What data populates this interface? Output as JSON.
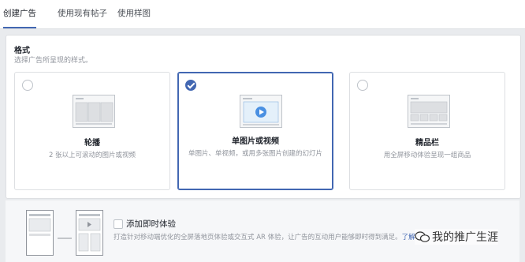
{
  "tabs": [
    {
      "label": "创建广告",
      "active": true
    },
    {
      "label": "使用现有帖子",
      "active": false
    },
    {
      "label": "使用样图",
      "active": false
    }
  ],
  "format": {
    "title": "格式",
    "subtitle": "选择广告所呈现的样式。",
    "options": [
      {
        "title": "轮播",
        "description": "2 张以上可滚动的图片或视频",
        "selected": false,
        "icon": "carousel-icon"
      },
      {
        "title": "单图片或视频",
        "description": "单图片、单视频，或用多张图片创建的幻灯片",
        "selected": true,
        "icon": "single-media-icon"
      },
      {
        "title": "精品栏",
        "description": "用全屏移动体验呈现一组商品",
        "selected": false,
        "icon": "collection-icon"
      }
    ]
  },
  "instant_experience": {
    "title": "添加即时体验",
    "description": "打造针对移动端优化的全屏落地页体验或交互式 AR 体验，让广告的互动用户能够即时得到满足。",
    "link": "了解",
    "checked": false
  },
  "watermark": {
    "text": "我的推广生涯"
  },
  "colors": {
    "accent": "#4267b2",
    "muted": "#90949c",
    "border": "#dddfe2"
  }
}
